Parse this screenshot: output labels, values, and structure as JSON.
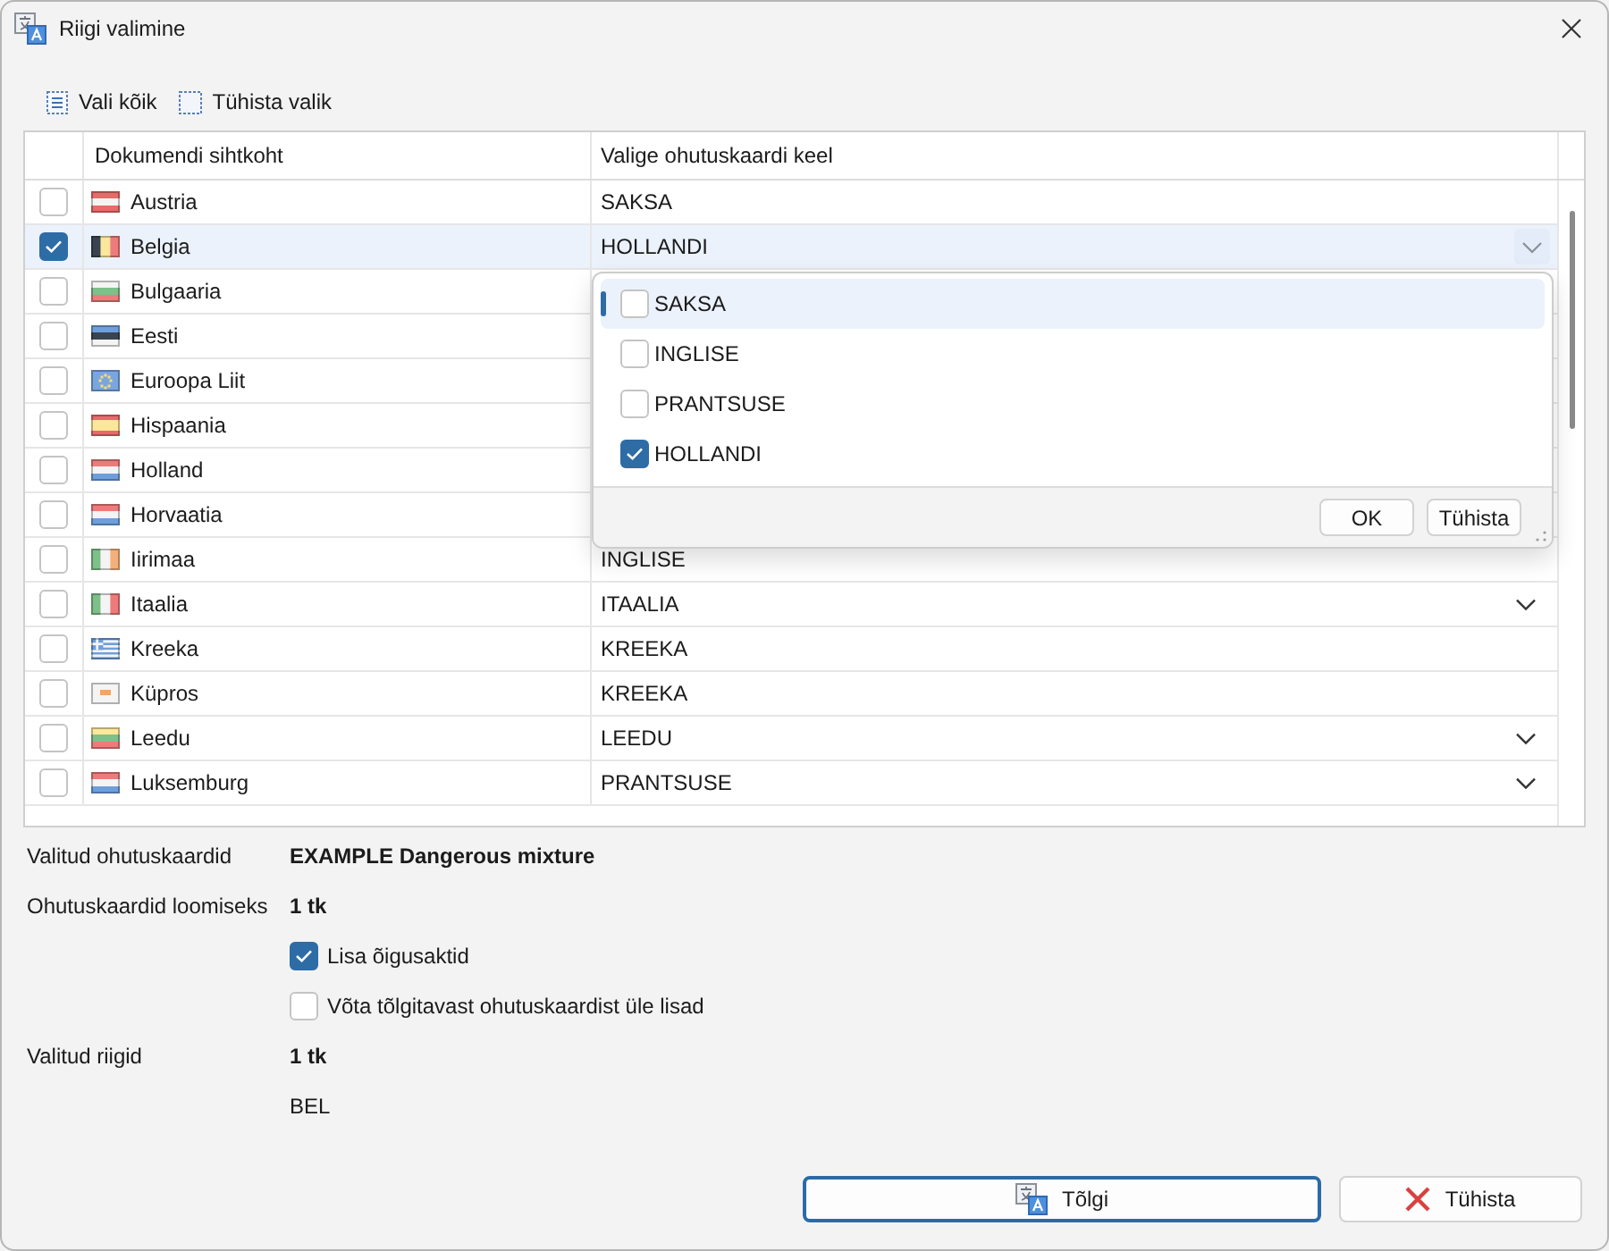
{
  "window": {
    "title": "Riigi valimine"
  },
  "toolbar": [
    {
      "kind": "select-all",
      "label": "Vali kõik"
    },
    {
      "kind": "clear",
      "label": "Tühista valik"
    }
  ],
  "table": {
    "columns": [
      "Dokumendi sihtkoht",
      "Valige ohutuskaardi keel"
    ],
    "rows": [
      {
        "checked": false,
        "selected": false,
        "country": "Austria",
        "flag": {
          "kind": "h",
          "parts": [
            {
              "color": "#e86a6a"
            },
            {
              "color": "#f4f4f4"
            },
            {
              "color": "#e86a6a"
            }
          ]
        },
        "language": "SAKSA",
        "dropdown": false
      },
      {
        "checked": true,
        "selected": true,
        "country": "Belgia",
        "flag": {
          "kind": "v",
          "parts": [
            {
              "color": "#3a4350"
            },
            {
              "color": "#fce79a"
            },
            {
              "color": "#ee7b7b"
            }
          ]
        },
        "language": "HOLLANDI",
        "dropdown": true
      },
      {
        "checked": false,
        "selected": false,
        "country": "Bulgaaria",
        "flag": {
          "kind": "h",
          "parts": [
            {
              "color": "#f4f4f4"
            },
            {
              "color": "#7fbf8a"
            },
            {
              "color": "#ee7b7b"
            }
          ]
        },
        "dropdown": false
      },
      {
        "checked": false,
        "selected": false,
        "country": "Eesti",
        "flag": {
          "kind": "h",
          "parts": [
            {
              "color": "#6e9fdc"
            },
            {
              "color": "#3a4350"
            },
            {
              "color": "#f4f4f4"
            }
          ]
        },
        "dropdown": false
      },
      {
        "checked": false,
        "selected": false,
        "country": "Euroopa Liit",
        "flag": {
          "kind": "eu",
          "parts": [
            {
              "color": "#7aa6e0"
            }
          ]
        },
        "dropdown": false
      },
      {
        "checked": false,
        "selected": false,
        "country": "Hispaania",
        "flag": {
          "kind": "h",
          "parts": [
            {
              "color": "#e86a6a"
            },
            {
              "color": "#fce79a"
            },
            {
              "color": "#fce79a"
            },
            {
              "color": "#e86a6a"
            }
          ]
        },
        "dropdown": false
      },
      {
        "checked": false,
        "selected": false,
        "country": "Holland",
        "flag": {
          "kind": "h",
          "parts": [
            {
              "color": "#ee7b7b"
            },
            {
              "color": "#f4f4f4"
            },
            {
              "color": "#6e9fdc"
            }
          ]
        },
        "dropdown": false
      },
      {
        "checked": false,
        "selected": false,
        "country": "Horvaatia",
        "flag": {
          "kind": "h",
          "parts": [
            {
              "color": "#ee7b7b"
            },
            {
              "color": "#f4f4f4"
            },
            {
              "color": "#6e9fdc"
            }
          ]
        },
        "dropdown": false
      },
      {
        "checked": false,
        "selected": false,
        "country": "Iirimaa",
        "flag": {
          "kind": "v",
          "parts": [
            {
              "color": "#7fbf8a"
            },
            {
              "color": "#f4f4f4"
            },
            {
              "color": "#f4b07a"
            }
          ]
        },
        "language": "INGLISE",
        "dropdown": false
      },
      {
        "checked": false,
        "selected": false,
        "country": "Itaalia",
        "flag": {
          "kind": "v",
          "parts": [
            {
              "color": "#7fbf8a"
            },
            {
              "color": "#f4f4f4"
            },
            {
              "color": "#ee7b7b"
            }
          ]
        },
        "language": "ITAALIA",
        "dropdown": true
      },
      {
        "checked": false,
        "selected": false,
        "country": "Kreeka",
        "flag": {
          "kind": "greece",
          "parts": [
            {
              "color": "#6e9fdc"
            },
            {
              "color": "#f4f4f4"
            }
          ]
        },
        "language": "KREEKA",
        "dropdown": false
      },
      {
        "checked": false,
        "selected": false,
        "country": "Küpros",
        "flag": {
          "kind": "cyprus",
          "parts": [
            {
              "color": "#f4f4f4"
            }
          ]
        },
        "language": "KREEKA",
        "dropdown": false
      },
      {
        "checked": false,
        "selected": false,
        "country": "Leedu",
        "flag": {
          "kind": "h",
          "parts": [
            {
              "color": "#fce79a"
            },
            {
              "color": "#7fbf8a"
            },
            {
              "color": "#ee7b7b"
            }
          ]
        },
        "language": "LEEDU",
        "dropdown": true
      },
      {
        "checked": false,
        "selected": false,
        "country": "Luksemburg",
        "flag": {
          "kind": "h",
          "parts": [
            {
              "color": "#ee7b7b"
            },
            {
              "color": "#f4f4f4"
            },
            {
              "color": "#6e9fdc"
            }
          ]
        },
        "language": "PRANTSUSE",
        "dropdown": true
      }
    ]
  },
  "language_popup": {
    "options": [
      {
        "label": "SAKSA",
        "checked": false,
        "selected": true
      },
      {
        "label": "INGLISE",
        "checked": false,
        "selected": false
      },
      {
        "label": "PRANTSUSE",
        "checked": false,
        "selected": false
      },
      {
        "label": "HOLLANDI",
        "checked": true,
        "selected": false
      }
    ],
    "buttons": [
      "OK",
      "Tühista"
    ]
  },
  "summary": [
    {
      "kind": "field",
      "label": "Valitud ohutuskaardid",
      "value": "EXAMPLE Dangerous mixture"
    },
    {
      "kind": "field",
      "label": "Ohutuskaardid loomiseks",
      "value": "1 tk"
    },
    {
      "kind": "checkbox",
      "label": "Lisa õigusaktid",
      "checked": true
    },
    {
      "kind": "checkbox",
      "label": "Võta tõlgitavast ohutuskaardist üle lisad",
      "checked": false
    },
    {
      "kind": "field",
      "label": "Valitud riigid",
      "value": "1 tk"
    },
    {
      "kind": "note",
      "value": "BEL"
    }
  ],
  "buttons": [
    {
      "kind": "translate",
      "label": "Tõlgi",
      "default": true
    },
    {
      "kind": "cancel",
      "label": "Tühista",
      "default": false
    }
  ]
}
